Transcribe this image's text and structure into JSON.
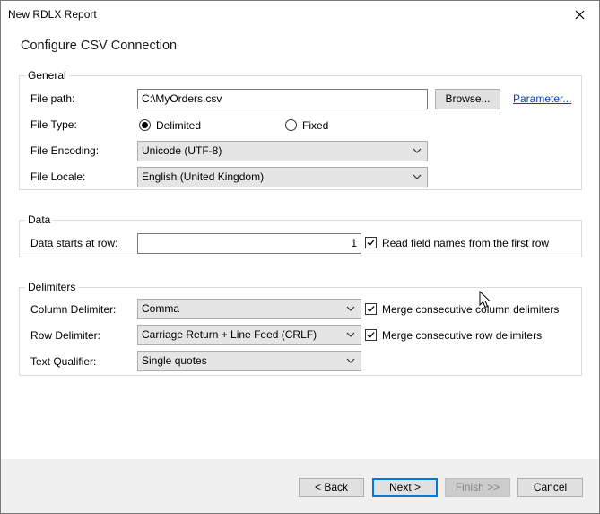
{
  "window": {
    "title": "New RDLX Report"
  },
  "heading": "Configure CSV Connection",
  "general": {
    "legend": "General",
    "file_path_label": "File path:",
    "file_path_value": "C:\\MyOrders.csv",
    "browse_label": "Browse...",
    "parameter_label": "Parameter...",
    "file_type_label": "File Type:",
    "delimited_label": "Delimited",
    "fixed_label": "Fixed",
    "file_type_selected": "Delimited",
    "file_encoding_label": "File Encoding:",
    "file_encoding_value": "Unicode (UTF-8)",
    "file_locale_label": "File Locale:",
    "file_locale_value": "English (United Kingdom)"
  },
  "data": {
    "legend": "Data",
    "starts_at_label": "Data starts at row:",
    "starts_at_value": "1",
    "read_field_names_label": "Read field names from the first row",
    "read_field_names_checked": true
  },
  "delimiters": {
    "legend": "Delimiters",
    "column_label": "Column Delimiter:",
    "column_value": "Comma",
    "merge_column_label": "Merge consecutive column delimiters",
    "merge_column_checked": true,
    "row_label": "Row Delimiter:",
    "row_value": "Carriage Return + Line Feed (CRLF)",
    "merge_row_label": "Merge consecutive row delimiters",
    "merge_row_checked": true,
    "qualifier_label": "Text Qualifier:",
    "qualifier_value": "Single quotes"
  },
  "footer": {
    "back_label": "< Back",
    "next_label": "Next >",
    "finish_label": "Finish >>",
    "cancel_label": "Cancel"
  },
  "icons": {
    "close": "close-icon",
    "chevron": "chevron-down-icon",
    "check": "check-icon",
    "cursor": "mouse-cursor-icon"
  },
  "colors": {
    "link": "#0645ad",
    "default_button_border": "#0078d7",
    "footer_bg": "#f0f0f0"
  }
}
